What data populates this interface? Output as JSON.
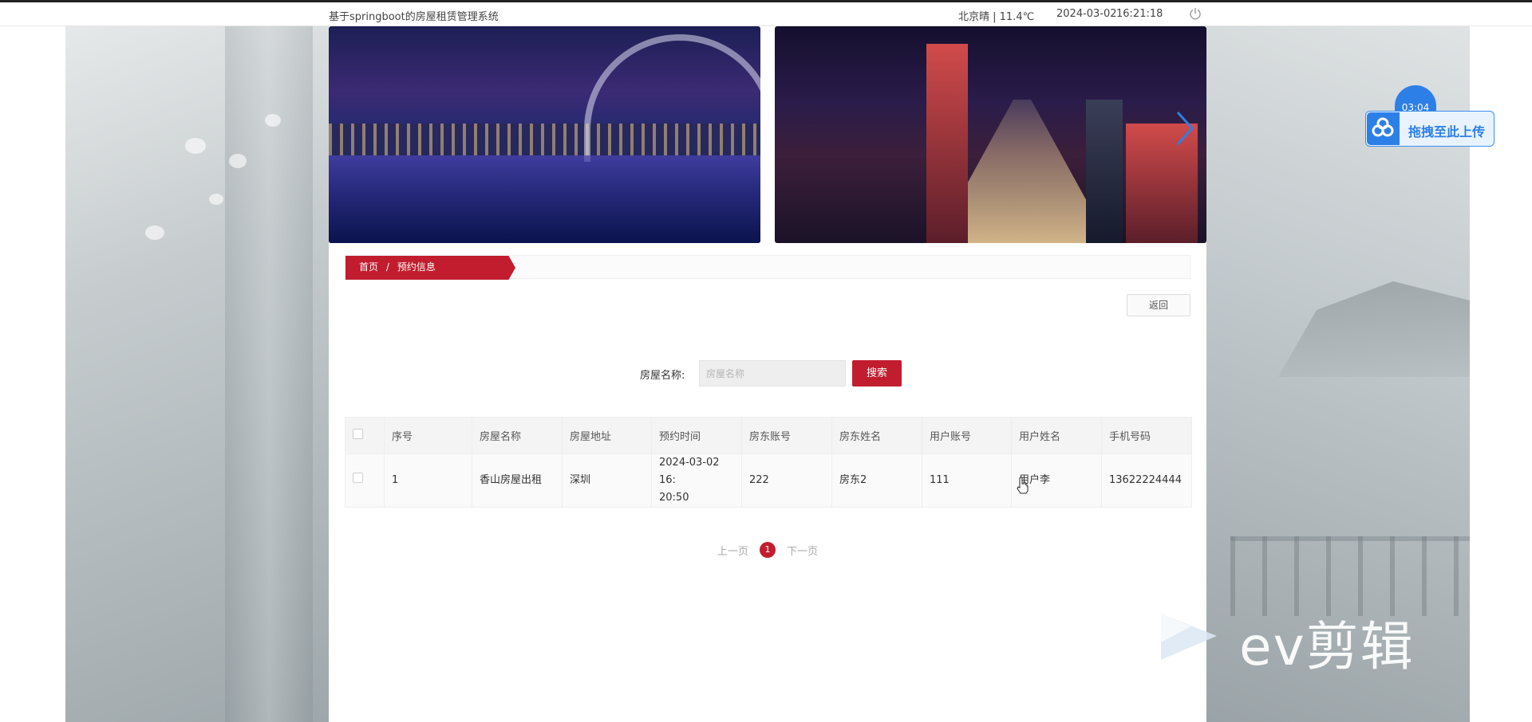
{
  "topbar": {
    "site_title": "基于springboot的房屋租赁管理系统",
    "weather": "北京晴 | 11.4℃",
    "date": "2024-03-02",
    "time": "16:21:18",
    "power_icon": "power-icon"
  },
  "banners": [
    {
      "name": "sydney-harbour-night"
    },
    {
      "name": "city-night-road"
    }
  ],
  "breadcrumb": {
    "home": "首页",
    "separator": "/",
    "current": "预约信息"
  },
  "back_label": "返回",
  "search": {
    "label": "房屋名称:",
    "placeholder": "房屋名称",
    "value": "",
    "button": "搜索"
  },
  "table": {
    "headers": [
      "序号",
      "房屋名称",
      "房屋地址",
      "预约时间",
      "房东账号",
      "房东姓名",
      "用户账号",
      "用户姓名",
      "手机号码"
    ],
    "rows": [
      {
        "index": "1",
        "house_name": "香山房屋出租",
        "address": "深圳",
        "appointment_time_1": "2024-03-02 16:",
        "appointment_time_2": "20:50",
        "landlord_account": "222",
        "landlord_name": "房东2",
        "user_account": "111",
        "user_name": "用户李",
        "phone": "13622224444"
      }
    ]
  },
  "pager": {
    "prev": "上一页",
    "current_page": "1",
    "next": "下一页"
  },
  "upload_widget": {
    "timer": "03:04",
    "label": "拖拽至此上传"
  },
  "watermark": {
    "text": "ev剪辑"
  },
  "colors": {
    "accent": "#c11d2e",
    "upload_blue": "#2d7fe8"
  }
}
